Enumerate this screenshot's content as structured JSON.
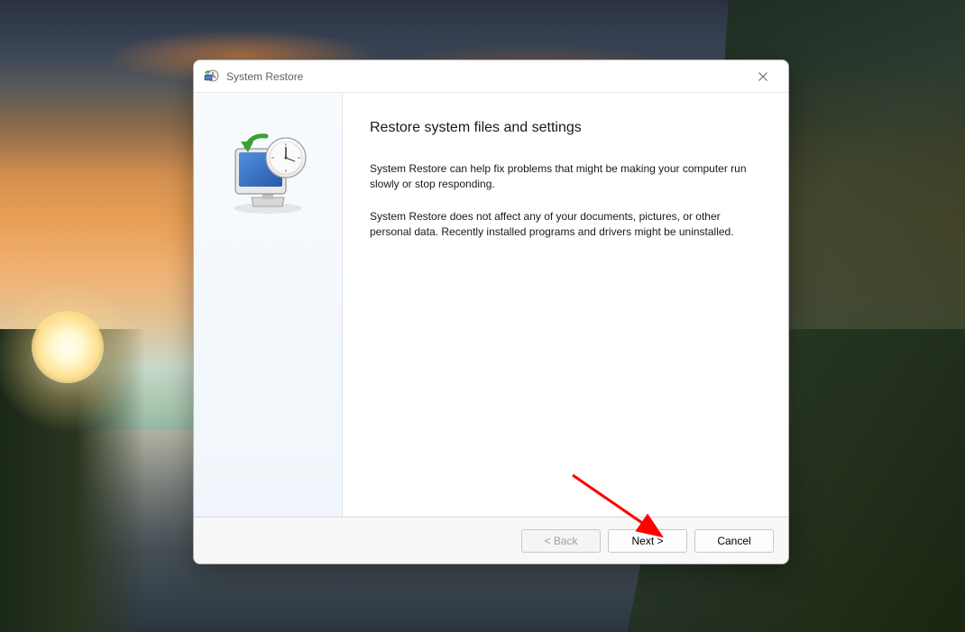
{
  "dialog": {
    "title": "System Restore",
    "heading": "Restore system files and settings",
    "paragraph1": "System Restore can help fix problems that might be making your computer run slowly or stop responding.",
    "paragraph2": "System Restore does not affect any of your documents, pictures, or other personal data. Recently installed programs and drivers might be uninstalled."
  },
  "buttons": {
    "back": "< Back",
    "next": "Next >",
    "cancel": "Cancel"
  },
  "icons": {
    "app": "system-restore-icon",
    "wizard": "monitor-clock-restore-icon",
    "close": "close-icon"
  }
}
